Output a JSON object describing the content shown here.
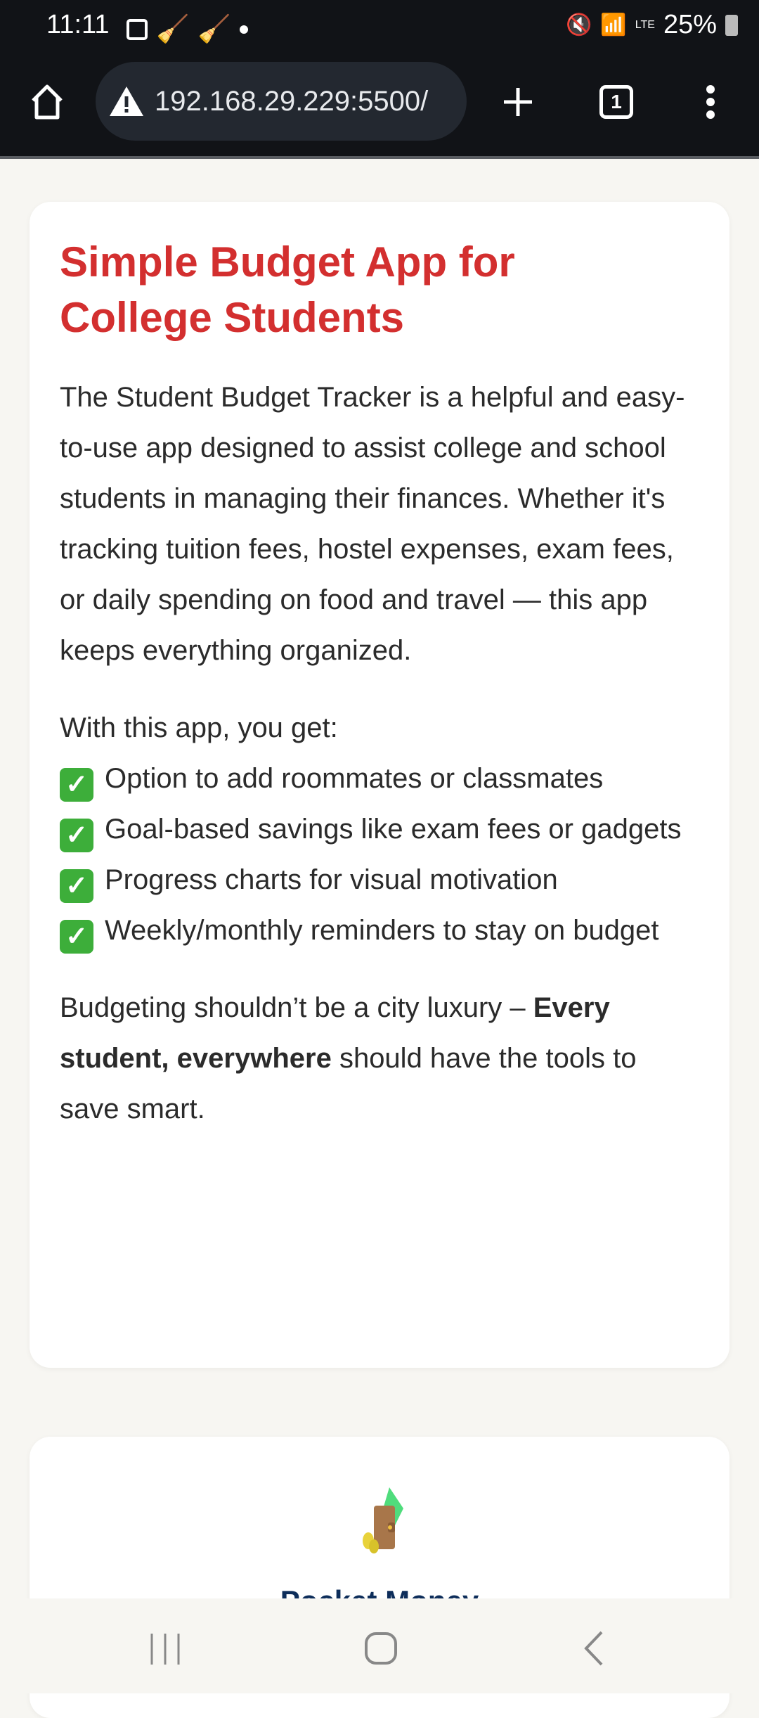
{
  "status": {
    "time": "11:11",
    "battery": "25%",
    "network": "LTE"
  },
  "browser": {
    "url": "192.168.29.229:5500/",
    "tab_count": "1"
  },
  "intro": {
    "title": "Simple Budget App for College Students",
    "description": "The Student Budget Tracker is a helpful and easy-to-use app designed to assist college and school students in managing their finances. Whether it's tracking tuition fees, hostel expenses, exam fees, or daily spending on food and travel — this app keeps everything organized.",
    "features_heading": "With this app, you get:",
    "features": [
      "Option to add roommates or classmates",
      "Goal-based savings like exam fees or gadgets",
      "Progress charts for visual motivation",
      "Weekly/monthly reminders to stay on budget"
    ],
    "closing_pre": "Budgeting shouldn’t be a city luxury – ",
    "closing_bold": "Every student, everywhere",
    "closing_post": " should have the tools to save smart."
  },
  "card2": {
    "icon": "wallet-icon",
    "title": "Pocket Money"
  },
  "colors": {
    "title": "#d32f2f",
    "accent": "#0d2d5a",
    "check": "#3dae3a"
  }
}
